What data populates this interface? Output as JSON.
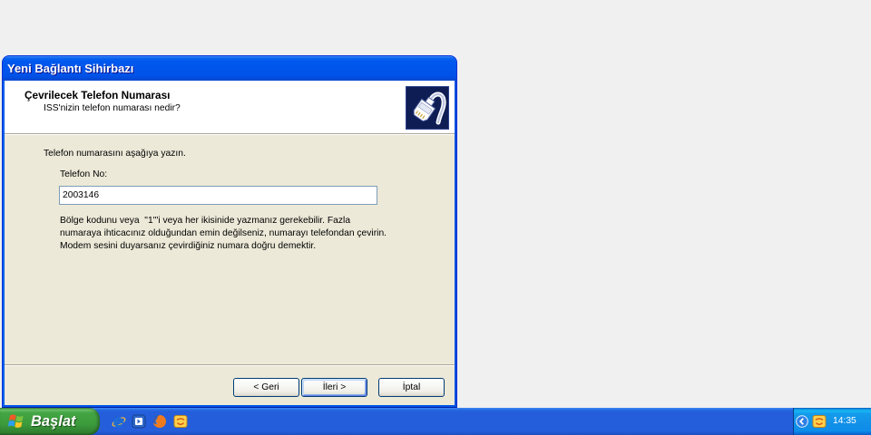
{
  "window": {
    "title": "Yeni Bağlantı Sihirbazı"
  },
  "header": {
    "title": "Çevrilecek Telefon Numarası",
    "subtitle": "ISS'nizin telefon numarası nedir?",
    "icon": "phone-plug-icon"
  },
  "body": {
    "instruction": "Telefon numarasını aşağıya yazın.",
    "phone_label": "Telefon No:",
    "phone_value": "2003146",
    "help_lines": [
      "Bölge kodunu veya  \"1\"'i veya her ikisinide yazmanız gerekebilir. Fazla",
      "numaraya ihticacınız olduğundan emin değilseniz, numarayı telefondan çevirin.",
      "Modem sesini duyarsanız çevirdiğiniz numara doğru demektir."
    ]
  },
  "buttons": {
    "back": "< Geri",
    "next": "İleri >",
    "cancel": "İptal"
  },
  "taskbar": {
    "start_label": "Başlat",
    "start_icon": "windows-logo-icon",
    "quick_launch": [
      "internet-explorer-icon",
      "media-player-icon",
      "firefox-icon",
      "yellow-app-icon"
    ],
    "tray": {
      "icons": [
        "chevron-left-icon",
        "yellow-app-icon"
      ],
      "clock": "14:35"
    }
  },
  "colors": {
    "desktop": "#f0f0f0",
    "title_bar": "#0058ee",
    "dialog_face": "#ece9d8",
    "header_bg": "#ffffff",
    "divider": "#aca899",
    "button_border": "#003c74",
    "input_border": "#7f9db9",
    "taskbar": "#245edb",
    "start_button": "#3c9b3c",
    "tray": "#1290e8"
  }
}
